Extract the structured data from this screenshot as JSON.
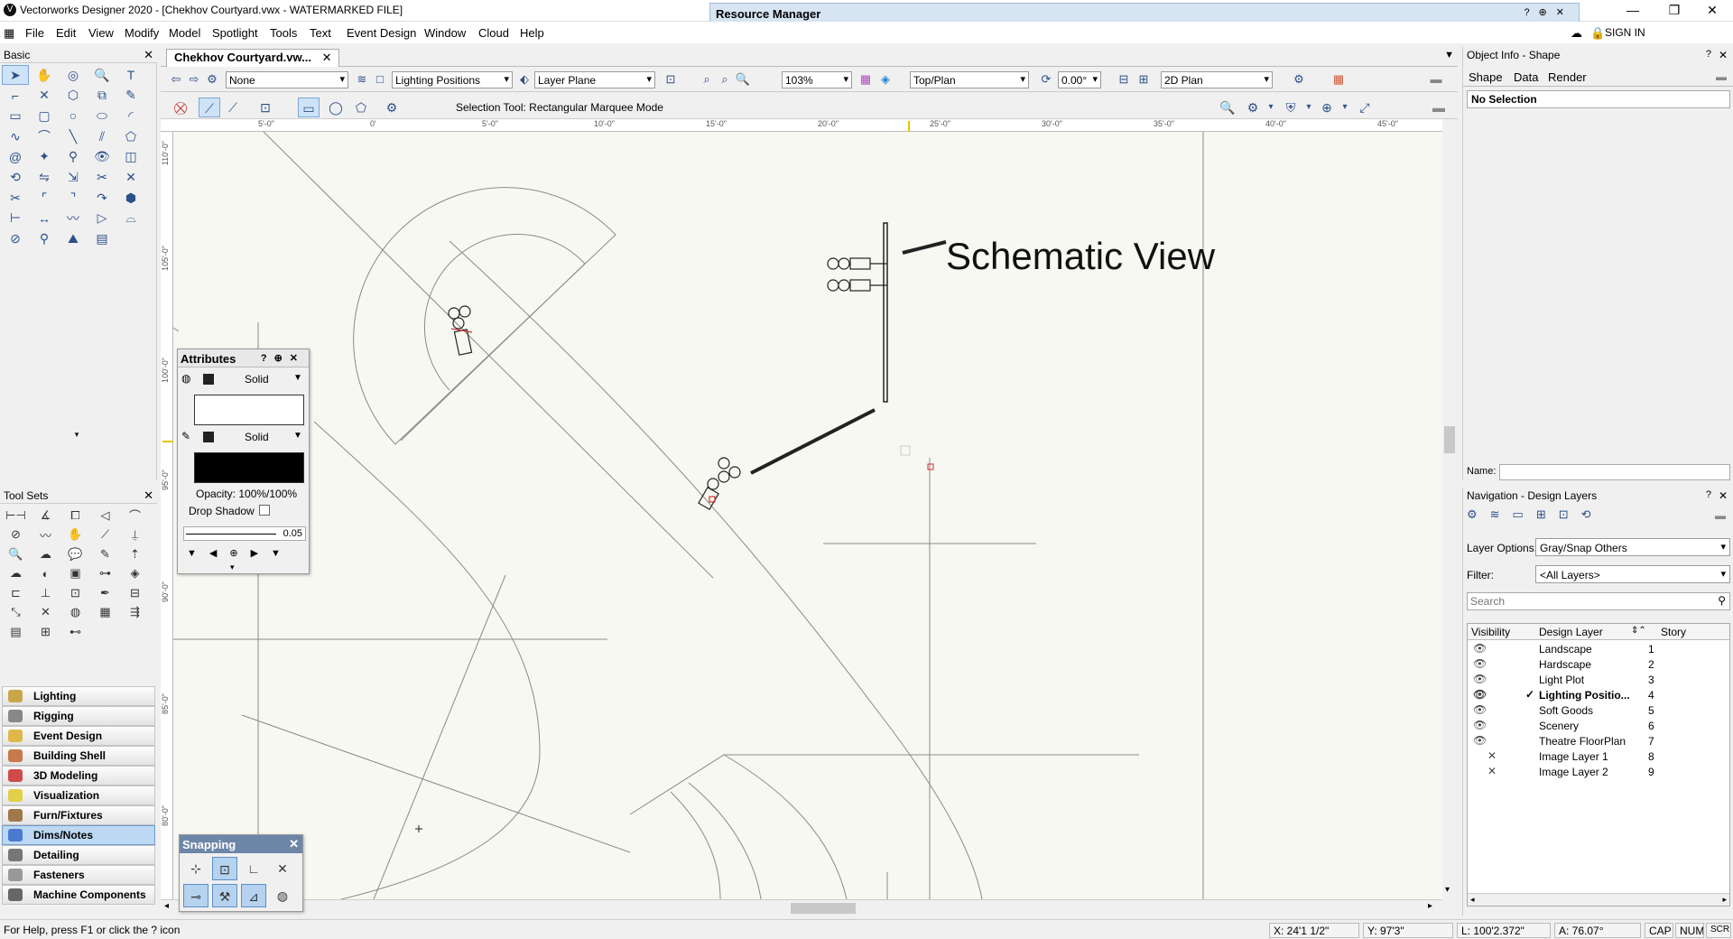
{
  "window": {
    "title": "Vectorworks Designer 2020 - [Chekhov Courtyard.vwx - WATERMARKED FILE]",
    "minimize": "—",
    "restore": "❐",
    "close": "✕",
    "sign_in": "SIGN IN"
  },
  "resource_manager": {
    "title": "Resource Manager"
  },
  "menu": [
    "File",
    "Edit",
    "View",
    "Modify",
    "Model",
    "Spotlight",
    "Tools",
    "Text",
    "Event Design",
    "Window",
    "Cloud",
    "Help"
  ],
  "basic_palette": {
    "title": "Basic"
  },
  "toolsets_palette": {
    "title": "Tool Sets",
    "categories": [
      "Lighting",
      "Rigging",
      "Event Design",
      "Building Shell",
      "3D Modeling",
      "Visualization",
      "Furn/Fixtures",
      "Dims/Notes",
      "Detailing",
      "Fasteners",
      "Machine Components"
    ],
    "active_category": "Dims/Notes"
  },
  "document": {
    "tab_label": "Chekhov Courtyard.vw...",
    "tab_close": "✕"
  },
  "view_bar": {
    "class_value": "None",
    "layer_value": "Lighting Positions",
    "plane_value": "Layer Plane",
    "zoom_value": "103%",
    "view_value": "Top/Plan",
    "rotation_value": "0.00°",
    "render_value": "2D Plan"
  },
  "mode_bar": {
    "text": "Selection Tool: Rectangular Marquee Mode"
  },
  "rulers": {
    "top": [
      "5'-0\"",
      "0'",
      "5'-0\"",
      "10'-0\"",
      "15'-0\"",
      "20'-0\"",
      "25'-0\"",
      "30'-0\"",
      "35'-0\"",
      "40'-0\"",
      "45'-0\""
    ],
    "left": [
      "110'-0\"",
      "105'-0\"",
      "100'-0\"",
      "95'-0\"",
      "90'-0\"",
      "85'-0\"",
      "80'-0\""
    ]
  },
  "drawing": {
    "annotation": "Schematic View"
  },
  "attributes": {
    "title": "Attributes",
    "fill_style": "Solid",
    "pen_style": "Solid",
    "opacity": "Opacity: 100%/100%",
    "drop_shadow": "Drop Shadow",
    "line_weight": "0.05",
    "fill_color": "#ffffff",
    "pen_color": "#000000"
  },
  "snapping": {
    "title": "Snapping"
  },
  "object_info": {
    "title": "Object Info - Shape",
    "tabs": [
      "Shape",
      "Data",
      "Render"
    ],
    "selection": "No Selection",
    "name_label": "Name:"
  },
  "navigation": {
    "title": "Navigation - Design Layers",
    "layer_options_label": "Layer Options:",
    "layer_options_value": "Gray/Snap Others",
    "filter_label": "Filter:",
    "filter_value": "<All Layers>",
    "search_placeholder": "Search",
    "columns": [
      "Visibility",
      "Design Layer",
      "Story"
    ],
    "layers": [
      {
        "name": "Landscape",
        "num": "1",
        "vis": "eye"
      },
      {
        "name": "Hardscape",
        "num": "2",
        "vis": "eye"
      },
      {
        "name": "Light Plot",
        "num": "3",
        "vis": "eye"
      },
      {
        "name": "Lighting Positio...",
        "num": "4",
        "vis": "eye",
        "active": true
      },
      {
        "name": "Soft Goods",
        "num": "5",
        "vis": "eye"
      },
      {
        "name": "Scenery",
        "num": "6",
        "vis": "eye"
      },
      {
        "name": "Theatre FloorPlan",
        "num": "7",
        "vis": "eye"
      },
      {
        "name": "Image Layer 1",
        "num": "8",
        "vis": "hidden"
      },
      {
        "name": "Image Layer 2",
        "num": "9",
        "vis": "hidden"
      }
    ]
  },
  "status_bar": {
    "help": "For Help, press F1 or click the ? icon",
    "x": "X: 24'1 1/2\"",
    "y": "Y: 97'3\"",
    "l": "L: 100'2.372\"",
    "a": "A: 76.07°",
    "cap": "CAP",
    "num": "NUM",
    "scrl": "SCRL"
  }
}
